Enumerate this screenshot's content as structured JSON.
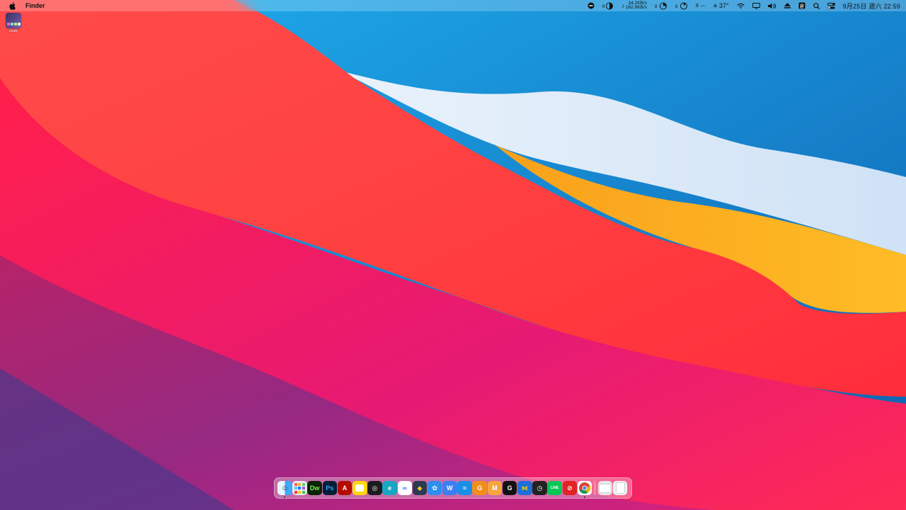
{
  "menubar": {
    "app_name": "Finder",
    "net_up": "14.2KB/s",
    "net_down": "162.9KB/s",
    "temperature": "37°",
    "dash": "--",
    "clock": "9月25日 週六 22:59"
  },
  "desktop": {
    "icons": [
      {
        "label": "Dock",
        "icon": "app-icon"
      }
    ]
  },
  "dock": {
    "apps": [
      {
        "name": "finder",
        "glyph": "",
        "bg": "#3fa9f5",
        "running": true
      },
      {
        "name": "launchpad",
        "glyph": "",
        "bg": "#e8e8ee"
      },
      {
        "name": "dreamweaver",
        "glyph": "Dw",
        "bg": "#072401",
        "fg": "#7ee85b"
      },
      {
        "name": "photoshop",
        "glyph": "Ps",
        "bg": "#001e36",
        "fg": "#31a8ff"
      },
      {
        "name": "acrobat",
        "glyph": "A",
        "bg": "#b30b00",
        "fg": "#ffffff"
      },
      {
        "name": "notes",
        "glyph": "",
        "bg": "#ffd60a"
      },
      {
        "name": "spiral",
        "glyph": "◎",
        "bg": "#1c1c1e",
        "fg": "#ffffff"
      },
      {
        "name": "edge-like",
        "glyph": "e",
        "bg": "#17a6c3"
      },
      {
        "name": "baidu-netdisk",
        "glyph": "∞",
        "bg": "#ffffff",
        "fg": "#2b7cf6"
      },
      {
        "name": "sourcetree",
        "glyph": "◆",
        "bg": "#2d3b50",
        "fg": "#ffc928"
      },
      {
        "name": "paw",
        "glyph": "✿",
        "bg": "#2d8ff0"
      },
      {
        "name": "w-app",
        "glyph": "W",
        "bg": "#3b7ff3"
      },
      {
        "name": "waves",
        "glyph": "≈",
        "bg": "#1b8fe6"
      },
      {
        "name": "g-orange",
        "glyph": "G",
        "bg": "#f28e1c"
      },
      {
        "name": "m-app",
        "glyph": "M",
        "bg": "#f7a440"
      },
      {
        "name": "g-hub",
        "glyph": "G",
        "bg": "#111111"
      },
      {
        "name": "vscode",
        "glyph": "⋈",
        "bg": "#1e6fd9",
        "fg": "#ffd200"
      },
      {
        "name": "clock",
        "glyph": "◷",
        "bg": "#222222"
      },
      {
        "name": "line",
        "glyph": "LINE",
        "bg": "#06c755"
      },
      {
        "name": "red-app",
        "glyph": "⊘",
        "bg": "#e02424"
      },
      {
        "name": "chrome",
        "glyph": "",
        "bg": "#ffffff",
        "running": true
      }
    ],
    "trailing": [
      {
        "name": "folder",
        "glyph": "",
        "bg": "#e6e9ee"
      },
      {
        "name": "trash",
        "glyph": "",
        "bg": "#f2f2f5"
      }
    ]
  },
  "colors": {
    "blue": "#1a86d0",
    "red": "#ff3240",
    "orange": "#ffa51f",
    "pink": "#e3197a",
    "purple": "#3c3a8e"
  }
}
